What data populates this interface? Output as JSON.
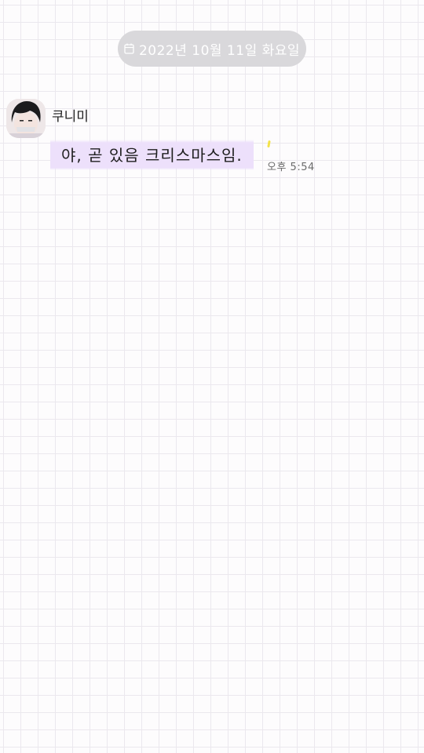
{
  "date_header": {
    "icon": "calendar-icon",
    "text": "2022년 10월 11일 화요일"
  },
  "messages": [
    {
      "sender": "쿠니미",
      "avatar": "avatar-image",
      "text": "야, 곧 있음 크리스마스임.",
      "time": "오후 5:54"
    }
  ],
  "colors": {
    "background": "#fdfcfd",
    "grid_line": "#ebe8ee",
    "date_pill": "#d9d8db",
    "bubble_highlight": "#ede0fb",
    "mark_yellow": "#f3e24a"
  }
}
